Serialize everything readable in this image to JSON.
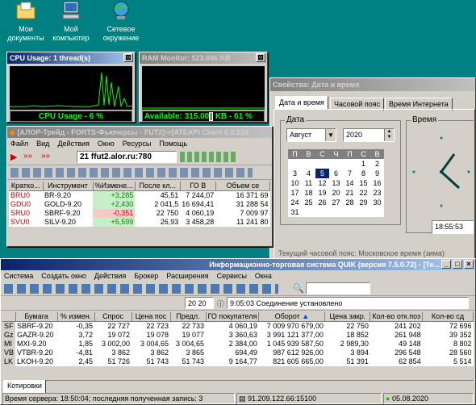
{
  "desktop_icons": [
    {
      "label": "Мои документы"
    },
    {
      "label": "Мой компьютер"
    },
    {
      "label": "Сетевое окружение"
    }
  ],
  "cpu": {
    "title": "CPU Usage: 1 thread(s)",
    "status": "CPU Usage - 6 %",
    "close": "⊠"
  },
  "ram": {
    "title": "RAM Monitor: 523.696 KB",
    "status_a": "Available: 315.00",
    "status_b": "KB - 61 %",
    "close": "⊠"
  },
  "datetime": {
    "title": "Свойства: Дата и время",
    "tabs": [
      "Дата и время",
      "Часовой пояс",
      "Время Интернета"
    ],
    "date_group": "Дата",
    "time_group": "Время",
    "month": "Август",
    "year": "2020",
    "weekdays": [
      "П",
      "В",
      "С",
      "Ч",
      "П",
      "С",
      "В"
    ],
    "weeks": [
      [
        "",
        "",
        "",
        "",
        "",
        "1",
        "2"
      ],
      [
        "3",
        "4",
        "5",
        "6",
        "7",
        "8",
        "9"
      ],
      [
        "10",
        "11",
        "12",
        "13",
        "14",
        "15",
        "16"
      ],
      [
        "17",
        "18",
        "19",
        "20",
        "21",
        "22",
        "23"
      ],
      [
        "24",
        "25",
        "26",
        "27",
        "28",
        "29",
        "30"
      ],
      [
        "31",
        "",
        "",
        "",
        "",
        "",
        ""
      ]
    ],
    "selected_day": "5",
    "time": "18:55:53",
    "tz_text": "Текущий часовой пояс: Московское время (зима)"
  },
  "alor": {
    "title": "[АЛОР-Трейд - FORTS-Фьючерсы - FUT2]->[ATEAPI Client 6.0.150.",
    "menu": [
      "Файл",
      "Вид",
      "Действия",
      "Окно",
      "Ресурсы",
      "Помощь"
    ],
    "server": "21 ffut2.alor.ru:780",
    "columns": [
      "Кратко...",
      "Инструмент",
      "%Измене...",
      "После кл...",
      "ГО В",
      "Объем се"
    ],
    "rows": [
      {
        "code": "BRU0",
        "inst": "BR-9.20",
        "chg": "+3,285",
        "after": "45,51",
        "go": "7 244,07",
        "vol": "16 371 69"
      },
      {
        "code": "GDU0",
        "inst": "GOLD-9.20",
        "chg": "+2,430",
        "after": "2 041,5",
        "go": "16 694,41",
        "vol": "31 288 54"
      },
      {
        "code": "SRU0",
        "inst": "SBRF-9.20",
        "chg": "-0,351",
        "after": "22 750",
        "go": "4 060,19",
        "vol": "7 009 97"
      },
      {
        "code": "SVU0",
        "inst": "SILV-9.20",
        "chg": "+5,599",
        "after": "26,93",
        "go": "3 458,28",
        "vol": "11 241 80"
      }
    ]
  },
  "quik": {
    "title": "Информационно-торговая система QUIK (версия 7.5.0.72) - [Те...",
    "menu": [
      "Система",
      "Создать окно",
      "Действия",
      "Брокер",
      "Расширения",
      "Сервисы",
      "Окна"
    ],
    "tool_value": "20 20",
    "conn_time": "9:05:03",
    "conn_text": "Соединение установлено",
    "columns": [
      "Бумага",
      "% измен.",
      "Спрос",
      "Цена пос",
      "Предл.",
      "ГО покупателя",
      "Оборот",
      "Цена закр.",
      "Кол-во отк.поз",
      "Кол-во сд"
    ],
    "rows": [
      {
        "pre": "SF",
        "name": "SBRF-9.20",
        "chg": "-0,35",
        "bid": "22 727",
        "last": "22 723",
        "ask": "22 733",
        "go": "4 060,19",
        "turn": "7 009 970 679,00",
        "close": "22 750",
        "oi": "241 202",
        "deals": "72 696"
      },
      {
        "pre": "Gz",
        "name": "GAZR-9.20",
        "chg": "3,72",
        "bid": "19 072",
        "last": "19 078",
        "ask": "19 077",
        "go": "3 360,63",
        "turn": "3 991 121 377,00",
        "close": "18 852",
        "oi": "261 948",
        "deals": "39 352"
      },
      {
        "pre": "MI",
        "name": "MXI-9.20",
        "chg": "1,85",
        "bid": "3 002,00",
        "last": "3 004,65",
        "ask": "3 004,65",
        "go": "2 384,00",
        "turn": "1 045 939 587,50",
        "close": "2 989,30",
        "oi": "49 148",
        "deals": "8 802"
      },
      {
        "pre": "VB",
        "name": "VTBR-9.20",
        "chg": "-4,81",
        "bid": "3 862",
        "last": "3 862",
        "ask": "3 865",
        "go": "694,49",
        "turn": "987 612 926,00",
        "close": "3 894",
        "oi": "296 548",
        "deals": "28 560"
      },
      {
        "pre": "LK",
        "name": "LKOH-9.20",
        "chg": "2,45",
        "bid": "51 726",
        "last": "51 743",
        "ask": "51 743",
        "go": "9 164,77",
        "turn": "821 605 665,00",
        "close": "51 391",
        "oi": "62 854",
        "deals": "5 514"
      }
    ],
    "tab": "Котировки",
    "status_left": "Время сервера: 18:50:04; последняя полученная запись: 3",
    "status_ip": "91.209.122.66:15100",
    "status_date": "05.08.2020"
  },
  "colors": {
    "accent_title": "#0a246a",
    "pos": "#008000",
    "neg": "#cc0000",
    "graph": "#00ff00"
  }
}
